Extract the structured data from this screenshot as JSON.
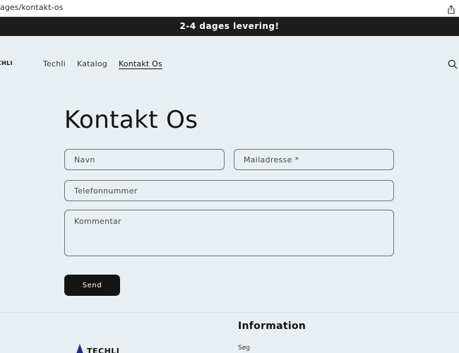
{
  "browser": {
    "url": "ages/kontakt-os",
    "share_icon": "share-icon"
  },
  "announcement": {
    "text": "2-4 dages levering!"
  },
  "header": {
    "logo_text": "CHLI",
    "nav": [
      {
        "label": "Techli"
      },
      {
        "label": "Katalog"
      },
      {
        "label": "Kontakt Os",
        "active": true
      }
    ],
    "search_icon": "search-icon"
  },
  "page": {
    "title": "Kontakt Os"
  },
  "form": {
    "name_placeholder": "Navn",
    "email_placeholder": "Mailadresse *",
    "phone_placeholder": "Telefonnummer",
    "comment_placeholder": "Kommentar",
    "submit_label": "Send"
  },
  "footer": {
    "heading": "Information",
    "links": [
      {
        "label": "Søg"
      }
    ],
    "logo_text": "TECHLI"
  },
  "colors": {
    "background": "#e8eef1",
    "announcement_bg": "#1d1d1d",
    "button_bg": "#141414",
    "logo_blue": "#1b2a8a"
  }
}
